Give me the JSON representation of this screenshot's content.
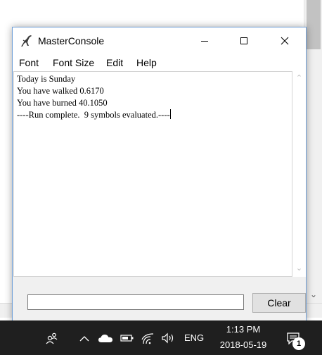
{
  "window": {
    "title": "MasterConsole"
  },
  "menu": {
    "items": [
      {
        "label": "Font"
      },
      {
        "label": "Font Size"
      },
      {
        "label": "Edit"
      },
      {
        "label": "Help"
      }
    ]
  },
  "output": {
    "lines": [
      "Today is Sunday",
      "You have walked 0.6170",
      "You have burned 40.1050",
      "----Run complete.  9 symbols evaluated.----"
    ]
  },
  "input": {
    "value": ""
  },
  "buttons": {
    "clear_label": "Clear"
  },
  "taskbar": {
    "language": "ENG",
    "time": "1:13 PM",
    "date": "2018-05-19",
    "notification_count": "1"
  },
  "colors": {
    "window_border": "#6f9fd8",
    "taskbar_bg": "#1f1f1f",
    "output_bg": "#ffffff",
    "client_bg": "#f0f0f0"
  }
}
